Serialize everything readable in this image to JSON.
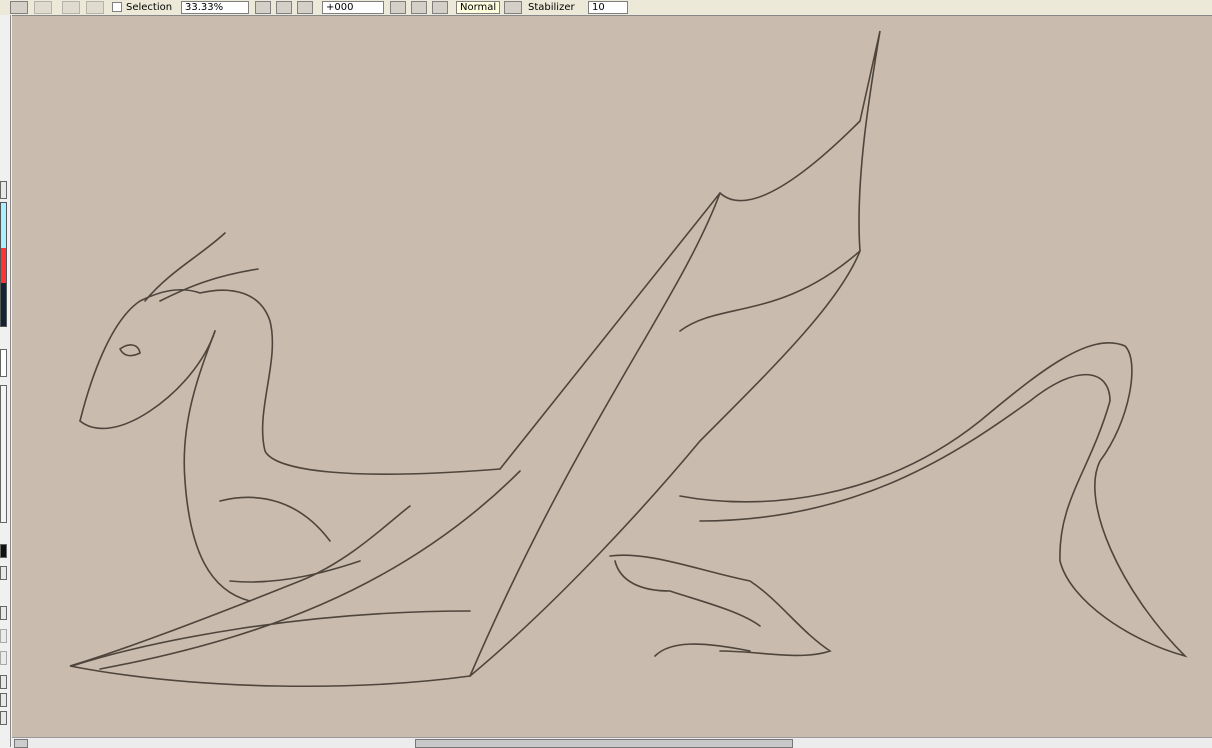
{
  "toolbar": {
    "selection_label": "Selection",
    "zoom_value": "33.33%",
    "rotation_value": "+000",
    "blend_mode": "Normal",
    "stabilizer_label": "Stabilizer",
    "stabilizer_value": "10"
  },
  "colors": {
    "canvas": "#c9bcae",
    "stroke": "#4a4038"
  }
}
